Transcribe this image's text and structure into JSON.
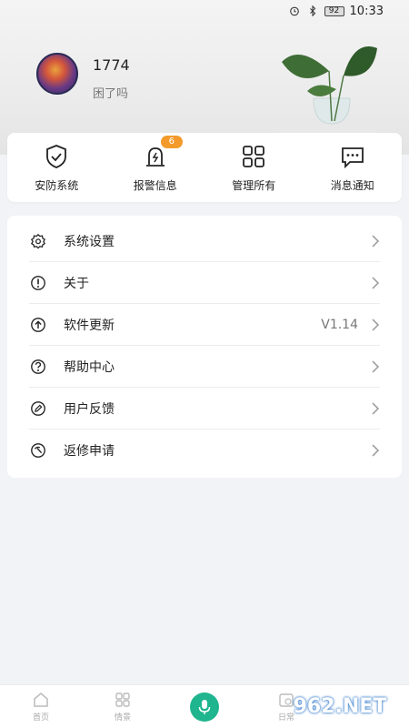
{
  "status_bar": {
    "battery": "92",
    "time": "10:33"
  },
  "profile": {
    "name": "1774",
    "subtitle": "困了吗"
  },
  "quick_actions": [
    {
      "label": "安防系统",
      "icon": "shield-check-icon"
    },
    {
      "label": "报警信息",
      "icon": "alarm-light-icon",
      "badge": "6"
    },
    {
      "label": "管理所有",
      "icon": "grid-icon"
    },
    {
      "label": "消息通知",
      "icon": "message-icon"
    }
  ],
  "settings": [
    {
      "label": "系统设置",
      "icon": "gear-icon",
      "value": ""
    },
    {
      "label": "关于",
      "icon": "info-icon",
      "value": ""
    },
    {
      "label": "软件更新",
      "icon": "upload-icon",
      "value": "V1.14"
    },
    {
      "label": "帮助中心",
      "icon": "help-icon",
      "value": ""
    },
    {
      "label": "用户反馈",
      "icon": "pen-icon",
      "value": ""
    },
    {
      "label": "返修申请",
      "icon": "repair-icon",
      "value": ""
    }
  ],
  "bottom_nav": [
    {
      "label": "首页",
      "icon": "home-icon"
    },
    {
      "label": "情景",
      "icon": "scene-grid-icon"
    },
    {
      "label": "",
      "icon": "microphone-icon"
    },
    {
      "label": "日常",
      "icon": "calendar-icon"
    }
  ],
  "watermark": "962.NET",
  "colors": {
    "accent": "#1fb58e",
    "badge": "#f39a2b"
  }
}
